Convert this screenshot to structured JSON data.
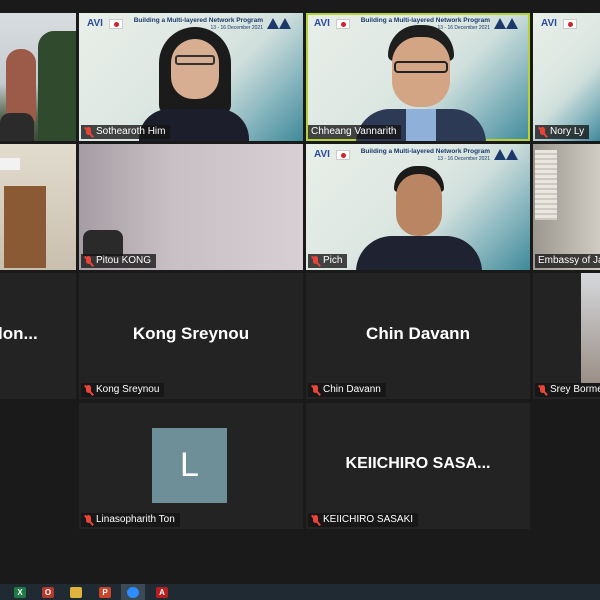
{
  "banner": {
    "logo": "AVI",
    "title": "Building a Multi-layered Network Program",
    "date": "13 - 16 December 2021"
  },
  "participants": [
    {
      "id": "p1",
      "name": ""
    },
    {
      "id": "p2",
      "name": "Sothearoth Him"
    },
    {
      "id": "p3",
      "name": "Chheang Vannarith"
    },
    {
      "id": "p4",
      "name": "Nory Ly"
    },
    {
      "id": "p5",
      "name": ""
    },
    {
      "id": "p6",
      "name": "Pitou KONG"
    },
    {
      "id": "p7",
      "name": "Pich"
    },
    {
      "id": "p8",
      "name": "Embassy of Jap"
    },
    {
      "id": "p9",
      "display": "lon...",
      "name": ""
    },
    {
      "id": "p10",
      "display": "Kong Sreynou",
      "name": "Kong Sreynou"
    },
    {
      "id": "p11",
      "display": "Chin Davann",
      "name": "Chin Davann"
    },
    {
      "id": "p12",
      "name": "Srey Borme"
    },
    {
      "id": "p13",
      "avatar_letter": "L",
      "name": "Linasopharith Ton"
    },
    {
      "id": "p14",
      "display": "KEIICHIRO  SASA...",
      "name": "KEIICHIRO SASAKI"
    }
  ],
  "taskbar": {
    "icons": [
      {
        "name": "excel-icon",
        "color": "#1f7a45",
        "glyph": "X"
      },
      {
        "name": "outlook-icon",
        "color": "#b33a2d",
        "glyph": "O"
      },
      {
        "name": "file-explorer-icon",
        "color": "#e0b33c",
        "glyph": ""
      },
      {
        "name": "powerpoint-icon",
        "color": "#c8452c",
        "glyph": "P"
      },
      {
        "name": "zoom-icon",
        "color": "#2d8cff",
        "glyph": ""
      },
      {
        "name": "acrobat-icon",
        "color": "#b81e1e",
        "glyph": "A"
      }
    ]
  },
  "colors": {
    "active_speaker": "#b5d334",
    "mic_muted": "#e8443a",
    "avatar_bg": "#6f8f98"
  }
}
